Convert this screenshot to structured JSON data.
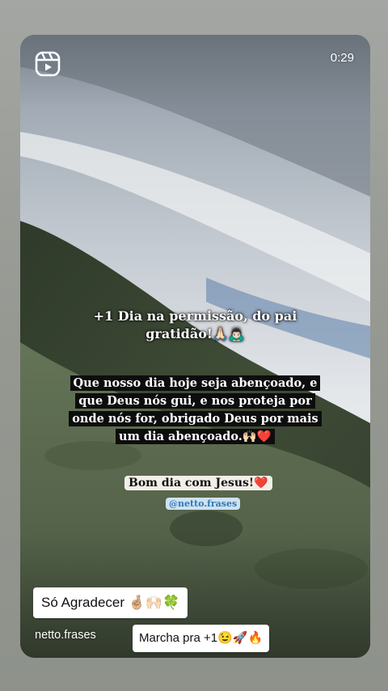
{
  "story": {
    "timer": "0:29",
    "reels_icon": "reels-icon"
  },
  "captions": {
    "line1": "+1 Dia na permissão, do pai",
    "line2": "gratidão!🙏🏻🙇🏻‍♂️",
    "message": [
      "Que nosso dia hoje seja abençoado, e",
      "que Deus nós gui, e nos proteja por",
      "onde nós for, obrigado Deus por mais",
      "um dia abençoado.🙌🏻❤️"
    ],
    "bom_dia": "Bom dia com Jesus!❤️",
    "handle": "@netto.frases"
  },
  "footer": {
    "username": "netto.frases",
    "sticker_agradecer": "Só Agradecer 🤞🏼🙌🏻🍀",
    "sticker_marcha": "Marcha pra +1😉🚀🔥"
  },
  "colors": {
    "sky": "#c9cfd6",
    "hill": "#3f4d35",
    "grass": "#5f7050",
    "handle_text": "#2e79b8"
  }
}
